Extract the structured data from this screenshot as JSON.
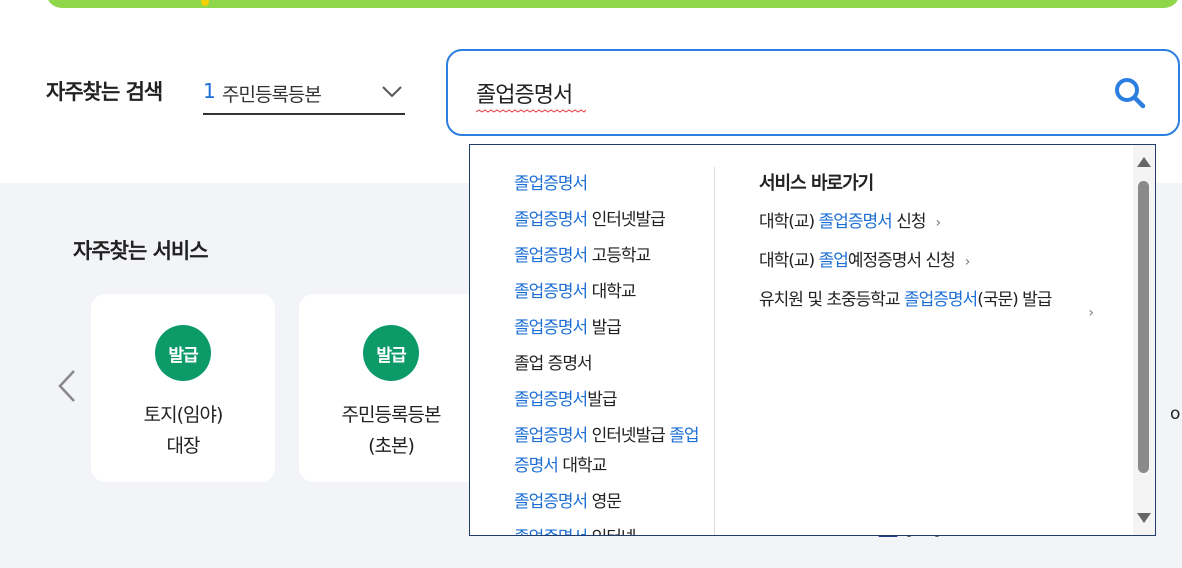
{
  "colors": {
    "accent": "#2c7fe0",
    "highlight": "#1d6fd6",
    "badge": "#0c9b68",
    "banner": "#8fd64a"
  },
  "quick_search": {
    "label": "자주찾는 검색",
    "rank": "1",
    "value": "주민등록등본"
  },
  "search": {
    "value": "졸업증명서"
  },
  "suggestions": [
    {
      "hl": "졸업증명서",
      "rest": ""
    },
    {
      "hl": "졸업증명서",
      "rest": " 인터넷발급"
    },
    {
      "hl": "졸업증명서",
      "rest": " 고등학교"
    },
    {
      "hl": "졸업증명서",
      "rest": " 대학교"
    },
    {
      "hl": "졸업증명서",
      "rest": " 발급"
    },
    {
      "hl": "",
      "rest": "졸업 증명서"
    },
    {
      "hl": "졸업증명서",
      "rest": "발급"
    },
    {
      "hl": "졸업증명서",
      "rest": " 인터넷발급 ",
      "hl2": "졸업증명서",
      "rest2": " 대학교"
    },
    {
      "hl": "졸업증명서",
      "rest": " 영문"
    },
    {
      "hl": "졸업증명서",
      "rest": " 인터넷"
    }
  ],
  "services": {
    "title": "서비스 바로가기",
    "items": [
      {
        "pre": "대학(교) ",
        "hl": "졸업증명서",
        "post": " 신청"
      },
      {
        "pre": "대학(교) ",
        "hl": "졸업",
        "post": "예정증명서 신청"
      },
      {
        "pre": "유치원 및 초중등학교 ",
        "hl": "졸업증명서",
        "post": "(국문) 발급"
      }
    ]
  },
  "frequent_services": {
    "title": "자주찾는 서비스",
    "cards": [
      {
        "badge": "발급",
        "line1": "토지(임야)",
        "line2": "대장"
      },
      {
        "badge": "발급",
        "line1": "주민등록등본",
        "line2": "(초본)"
      }
    ],
    "edge_text": "o"
  },
  "icons": [
    "chevron-down-icon",
    "search-icon",
    "chevron-left-icon",
    "chevron-right-icon",
    "scroll-up-icon",
    "scroll-down-icon"
  ]
}
